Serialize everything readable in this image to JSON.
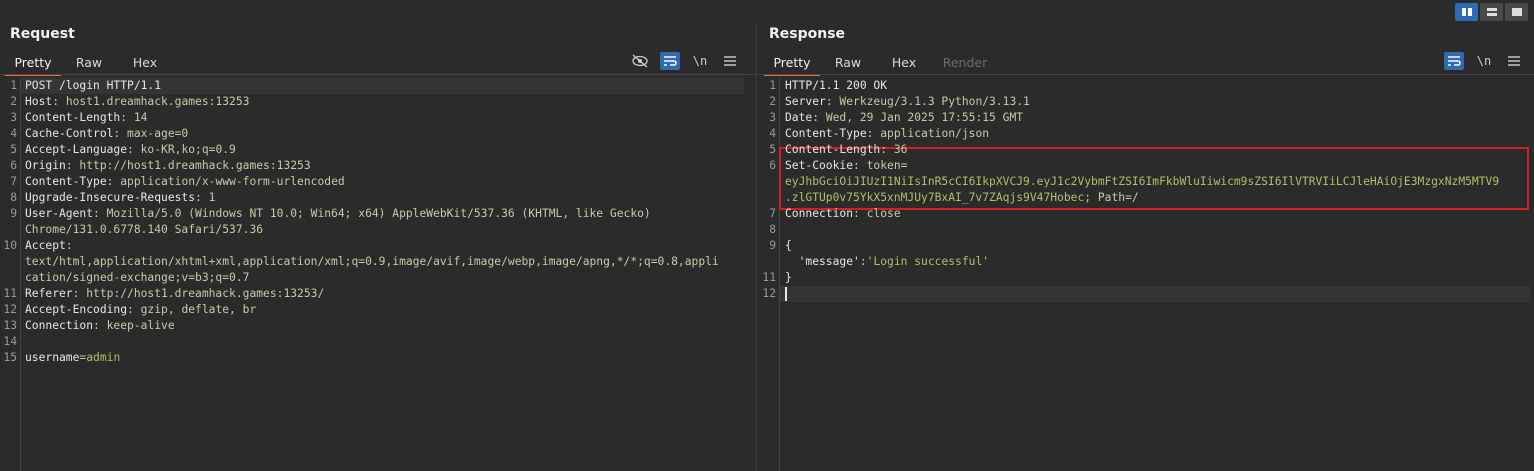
{
  "layout_buttons": [
    "side-by-side",
    "stacked",
    "single"
  ],
  "request": {
    "title": "Request",
    "tabs": [
      "Pretty",
      "Raw",
      "Hex"
    ],
    "active_tab": "Pretty",
    "tool_newline": "\\n",
    "lines": [
      {
        "n": "1",
        "k": "POST /login HTTP/1.1",
        "v": ""
      },
      {
        "n": "2",
        "k": "Host",
        "v": ": host1.dreamhack.games:13253"
      },
      {
        "n": "3",
        "k": "Content-Length",
        "v": ": 14"
      },
      {
        "n": "4",
        "k": "Cache-Control",
        "v": ": max-age=0"
      },
      {
        "n": "5",
        "k": "Accept-Language",
        "v": ": ko-KR,ko;q=0.9"
      },
      {
        "n": "6",
        "k": "Origin",
        "v": ": http://host1.dreamhack.games:13253"
      },
      {
        "n": "7",
        "k": "Content-Type",
        "v": ": application/x-www-form-urlencoded"
      },
      {
        "n": "8",
        "k": "Upgrade-Insecure-Requests",
        "v": ": 1"
      },
      {
        "n": "9",
        "k": "User-Agent",
        "v": ": Mozilla/5.0 (Windows NT 10.0; Win64; x64) AppleWebKit/537.36 (KHTML, like Gecko)"
      },
      {
        "n": "",
        "k": "",
        "v": "Chrome/131.0.6778.140 Safari/537.36"
      },
      {
        "n": "10",
        "k": "Accept",
        "v": ":"
      },
      {
        "n": "",
        "k": "",
        "v": "text/html,application/xhtml+xml,application/xml;q=0.9,image/avif,image/webp,image/apng,*/*;q=0.8,appli"
      },
      {
        "n": "",
        "k": "",
        "v": "cation/signed-exchange;v=b3;q=0.7"
      },
      {
        "n": "11",
        "k": "Referer",
        "v": ": http://host1.dreamhack.games:13253/"
      },
      {
        "n": "12",
        "k": "Accept-Encoding",
        "v": ": gzip, deflate, br"
      },
      {
        "n": "13",
        "k": "Connection",
        "v": ": keep-alive"
      },
      {
        "n": "14",
        "k": "",
        "v": ""
      },
      {
        "n": "15",
        "k": "username",
        "v": "=",
        "tail": "admin"
      }
    ]
  },
  "response": {
    "title": "Response",
    "tabs": [
      "Pretty",
      "Raw",
      "Hex",
      "Render"
    ],
    "active_tab": "Pretty",
    "tool_newline": "\\n",
    "lines": [
      {
        "n": "1",
        "k": "HTTP/1.1 200 OK",
        "v": ""
      },
      {
        "n": "2",
        "k": "Server",
        "v": ": Werkzeug/3.1.3 Python/3.13.1"
      },
      {
        "n": "3",
        "k": "Date",
        "v": ": Wed, 29 Jan 2025 17:55:15 GMT"
      },
      {
        "n": "4",
        "k": "Content-Type",
        "v": ": application/json"
      },
      {
        "n": "5",
        "k": "Content-Length",
        "v": ": 36"
      },
      {
        "n": "6",
        "k": "Set-Cookie",
        "v": ": token="
      },
      {
        "n": "",
        "k": "",
        "v": "",
        "tok": "eyJhbGciOiJIUzI1NiIsInR5cCI6IkpXVCJ9.eyJ1c2VybmFtZSI6ImFkbWluIiwicm9sZSI6IlVTRVIiLCJleHAiOjE3MzgxNzM5MTV9"
      },
      {
        "n": "",
        "k": "",
        "v": "; Path=/",
        "tok": ".zlGTUp0v75YkX5xnMJUy7BxAI_7v7ZAqjs9V47Hobec"
      },
      {
        "n": "7",
        "k": "Connection",
        "v": ": close"
      },
      {
        "n": "8",
        "k": "",
        "v": ""
      },
      {
        "n": "9",
        "k": "{",
        "v": ""
      },
      {
        "n": "",
        "k": "  'message'",
        "v": ":",
        "tail": "'Login successful'"
      },
      {
        "n": "11",
        "k": "}",
        "v": ""
      },
      {
        "n": "12",
        "k": "",
        "v": ""
      }
    ]
  }
}
